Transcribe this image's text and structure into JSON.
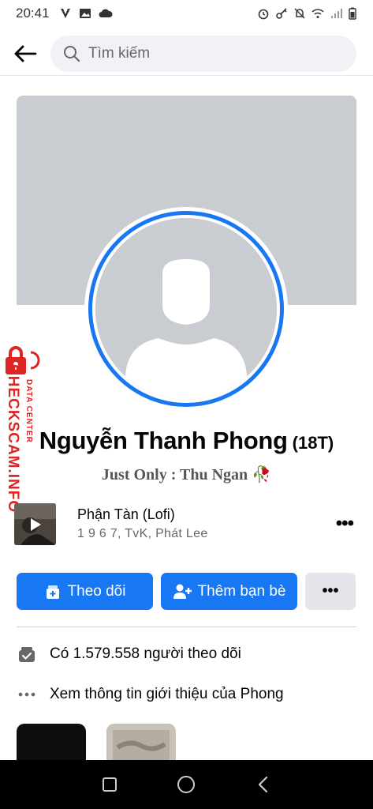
{
  "status_bar": {
    "time": "20:41"
  },
  "search": {
    "placeholder": "Tìm kiếm"
  },
  "profile": {
    "name": "Nguyễn Thanh Phong",
    "nickname": "(18T)",
    "bio": "Just Only : Thu Ngan 🥀"
  },
  "watermark": {
    "main": "CHECKSCAM.INFO",
    "sub": "DATA CENTER"
  },
  "music": {
    "title": "Phận Tàn (Lofi)",
    "artist": "1 9 6 7, TvK, Phát Lee",
    "more": "•••"
  },
  "actions": {
    "follow_label": "Theo dõi",
    "add_friend_label": "Thêm bạn bè",
    "more_label": "•••"
  },
  "info": {
    "followers": "Có 1.579.558 người theo dõi",
    "about": "Xem thông tin giới thiệu của Phong"
  },
  "colors": {
    "accent": "#1877f2",
    "cover": "#c9ccd1",
    "watermark": "#e02424"
  }
}
